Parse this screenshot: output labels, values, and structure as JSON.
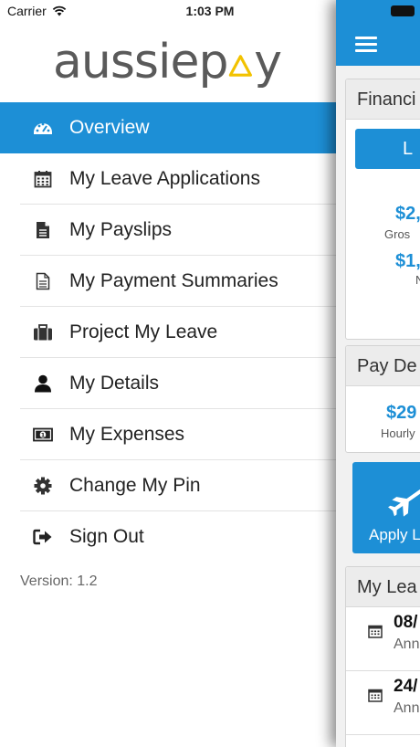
{
  "status_bar": {
    "carrier": "Carrier",
    "time": "1:03 PM"
  },
  "drawer": {
    "logo": {
      "text_before": "aussiep",
      "text_after": "y",
      "accent_color": "#f2c200"
    },
    "menu_items": [
      {
        "label": "Overview",
        "icon": "dashboard-icon",
        "active": true
      },
      {
        "label": "My Leave Applications",
        "icon": "calendar-icon",
        "active": false
      },
      {
        "label": "My Payslips",
        "icon": "document-icon",
        "active": false
      },
      {
        "label": "My Payment Summaries",
        "icon": "document-outline-icon",
        "active": false
      },
      {
        "label": "Project My Leave",
        "icon": "briefcase-icon",
        "active": false
      },
      {
        "label": "My Details",
        "icon": "user-icon",
        "active": false
      },
      {
        "label": "My Expenses",
        "icon": "money-icon",
        "active": false
      },
      {
        "label": "Change My Pin",
        "icon": "gear-icon",
        "active": false
      },
      {
        "label": "Sign Out",
        "icon": "sign-out-icon",
        "active": false
      }
    ],
    "version": "Version: 1.2"
  },
  "main": {
    "accent_color": "#1d8fd6",
    "financial_card": {
      "title": "Financi",
      "button_label": "L",
      "amount_1": "$2,",
      "amount_1_sub": "Gros",
      "amount_2": "$1,",
      "amount_2_sub": "N"
    },
    "pay_card": {
      "title": "Pay De",
      "amount": "$29",
      "amount_sub": "Hourly"
    },
    "apply_tile": {
      "label": "Apply L",
      "icon": "airplane-icon"
    },
    "leave_card": {
      "title": "My Lea",
      "rows": [
        {
          "date": "08/",
          "type": "Ann"
        },
        {
          "date": "24/",
          "type": "Ann"
        }
      ]
    }
  }
}
